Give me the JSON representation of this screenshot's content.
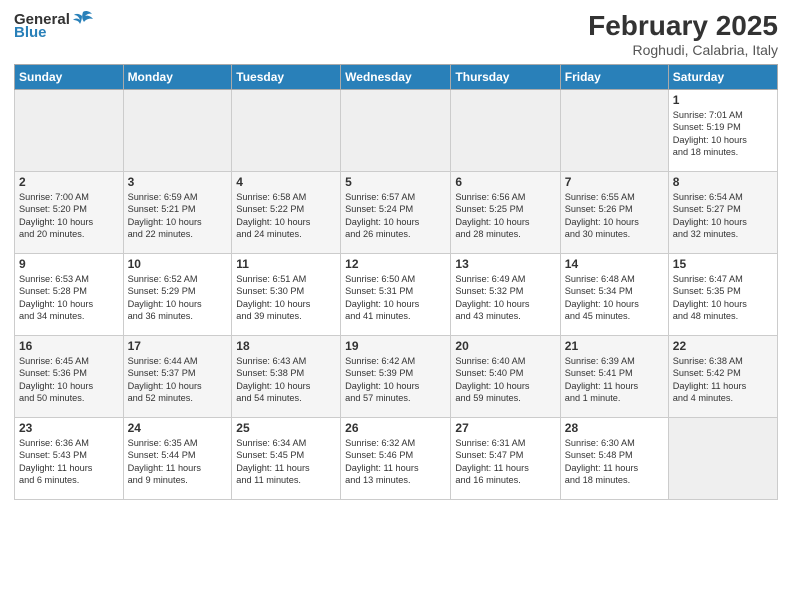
{
  "header": {
    "logo_general": "General",
    "logo_blue": "Blue",
    "month_title": "February 2025",
    "location": "Roghudi, Calabria, Italy"
  },
  "days_of_week": [
    "Sunday",
    "Monday",
    "Tuesday",
    "Wednesday",
    "Thursday",
    "Friday",
    "Saturday"
  ],
  "weeks": [
    [
      {
        "num": "",
        "info": ""
      },
      {
        "num": "",
        "info": ""
      },
      {
        "num": "",
        "info": ""
      },
      {
        "num": "",
        "info": ""
      },
      {
        "num": "",
        "info": ""
      },
      {
        "num": "",
        "info": ""
      },
      {
        "num": "1",
        "info": "Sunrise: 7:01 AM\nSunset: 5:19 PM\nDaylight: 10 hours\nand 18 minutes."
      }
    ],
    [
      {
        "num": "2",
        "info": "Sunrise: 7:00 AM\nSunset: 5:20 PM\nDaylight: 10 hours\nand 20 minutes."
      },
      {
        "num": "3",
        "info": "Sunrise: 6:59 AM\nSunset: 5:21 PM\nDaylight: 10 hours\nand 22 minutes."
      },
      {
        "num": "4",
        "info": "Sunrise: 6:58 AM\nSunset: 5:22 PM\nDaylight: 10 hours\nand 24 minutes."
      },
      {
        "num": "5",
        "info": "Sunrise: 6:57 AM\nSunset: 5:24 PM\nDaylight: 10 hours\nand 26 minutes."
      },
      {
        "num": "6",
        "info": "Sunrise: 6:56 AM\nSunset: 5:25 PM\nDaylight: 10 hours\nand 28 minutes."
      },
      {
        "num": "7",
        "info": "Sunrise: 6:55 AM\nSunset: 5:26 PM\nDaylight: 10 hours\nand 30 minutes."
      },
      {
        "num": "8",
        "info": "Sunrise: 6:54 AM\nSunset: 5:27 PM\nDaylight: 10 hours\nand 32 minutes."
      }
    ],
    [
      {
        "num": "9",
        "info": "Sunrise: 6:53 AM\nSunset: 5:28 PM\nDaylight: 10 hours\nand 34 minutes."
      },
      {
        "num": "10",
        "info": "Sunrise: 6:52 AM\nSunset: 5:29 PM\nDaylight: 10 hours\nand 36 minutes."
      },
      {
        "num": "11",
        "info": "Sunrise: 6:51 AM\nSunset: 5:30 PM\nDaylight: 10 hours\nand 39 minutes."
      },
      {
        "num": "12",
        "info": "Sunrise: 6:50 AM\nSunset: 5:31 PM\nDaylight: 10 hours\nand 41 minutes."
      },
      {
        "num": "13",
        "info": "Sunrise: 6:49 AM\nSunset: 5:32 PM\nDaylight: 10 hours\nand 43 minutes."
      },
      {
        "num": "14",
        "info": "Sunrise: 6:48 AM\nSunset: 5:34 PM\nDaylight: 10 hours\nand 45 minutes."
      },
      {
        "num": "15",
        "info": "Sunrise: 6:47 AM\nSunset: 5:35 PM\nDaylight: 10 hours\nand 48 minutes."
      }
    ],
    [
      {
        "num": "16",
        "info": "Sunrise: 6:45 AM\nSunset: 5:36 PM\nDaylight: 10 hours\nand 50 minutes."
      },
      {
        "num": "17",
        "info": "Sunrise: 6:44 AM\nSunset: 5:37 PM\nDaylight: 10 hours\nand 52 minutes."
      },
      {
        "num": "18",
        "info": "Sunrise: 6:43 AM\nSunset: 5:38 PM\nDaylight: 10 hours\nand 54 minutes."
      },
      {
        "num": "19",
        "info": "Sunrise: 6:42 AM\nSunset: 5:39 PM\nDaylight: 10 hours\nand 57 minutes."
      },
      {
        "num": "20",
        "info": "Sunrise: 6:40 AM\nSunset: 5:40 PM\nDaylight: 10 hours\nand 59 minutes."
      },
      {
        "num": "21",
        "info": "Sunrise: 6:39 AM\nSunset: 5:41 PM\nDaylight: 11 hours\nand 1 minute."
      },
      {
        "num": "22",
        "info": "Sunrise: 6:38 AM\nSunset: 5:42 PM\nDaylight: 11 hours\nand 4 minutes."
      }
    ],
    [
      {
        "num": "23",
        "info": "Sunrise: 6:36 AM\nSunset: 5:43 PM\nDaylight: 11 hours\nand 6 minutes."
      },
      {
        "num": "24",
        "info": "Sunrise: 6:35 AM\nSunset: 5:44 PM\nDaylight: 11 hours\nand 9 minutes."
      },
      {
        "num": "25",
        "info": "Sunrise: 6:34 AM\nSunset: 5:45 PM\nDaylight: 11 hours\nand 11 minutes."
      },
      {
        "num": "26",
        "info": "Sunrise: 6:32 AM\nSunset: 5:46 PM\nDaylight: 11 hours\nand 13 minutes."
      },
      {
        "num": "27",
        "info": "Sunrise: 6:31 AM\nSunset: 5:47 PM\nDaylight: 11 hours\nand 16 minutes."
      },
      {
        "num": "28",
        "info": "Sunrise: 6:30 AM\nSunset: 5:48 PM\nDaylight: 11 hours\nand 18 minutes."
      },
      {
        "num": "",
        "info": ""
      }
    ]
  ]
}
